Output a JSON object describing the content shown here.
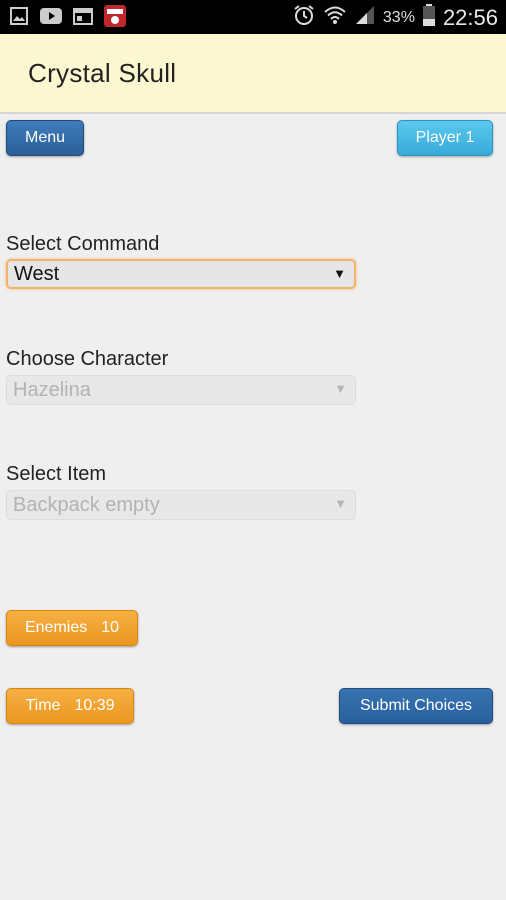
{
  "status_bar": {
    "battery_percent": "33%",
    "time": "22:56",
    "icons": [
      "image-icon",
      "youtube-icon",
      "calendar-icon",
      "app-badge-icon",
      "alarm-icon",
      "wifi-icon",
      "signal-icon",
      "battery-icon"
    ]
  },
  "header": {
    "title": "Crystal Skull"
  },
  "toolbar": {
    "menu_label": "Menu",
    "player_label": "Player 1"
  },
  "form": {
    "command": {
      "label": "Select Command",
      "value": "West"
    },
    "character": {
      "label": "Choose Character",
      "value": "Hazelina"
    },
    "item": {
      "label": "Select Item",
      "value": "Backpack empty"
    }
  },
  "stats": {
    "enemies_label": "Enemies",
    "enemies_value": "10",
    "time_label": "Time",
    "time_value": "10:39"
  },
  "actions": {
    "submit_label": "Submit Choices"
  },
  "colors": {
    "header_bg": "#fbf7d0",
    "primary_blue": "#2d64a0",
    "info_blue": "#45b6e3",
    "warning_orange": "#f0a030"
  }
}
